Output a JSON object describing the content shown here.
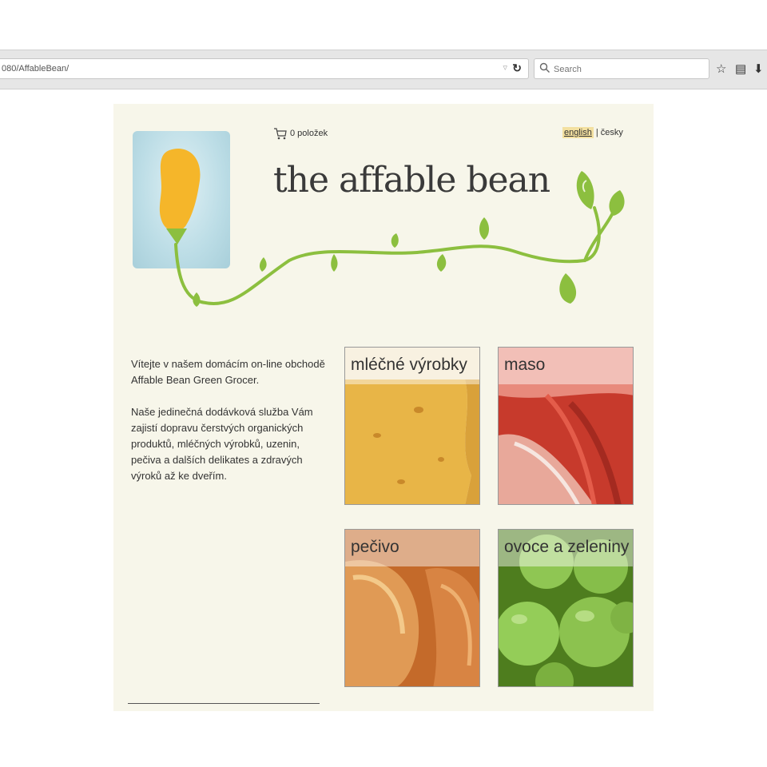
{
  "browser": {
    "url": "080/AffableBean/",
    "search_placeholder": "Search"
  },
  "header": {
    "cart_text": "0 položek",
    "lang_english": "english",
    "lang_separator": "|",
    "lang_czech": "česky",
    "brand": "the affable bean"
  },
  "welcome": {
    "para1": "Vítejte v našem domácím on-line obchodě Affable Bean Green Grocer.",
    "para2": "Naše jedinečná dodávková služba Vám zajistí dopravu čerstvých organických produktů, mléčných výrobků, uzenin, pečiva a dalších delikates a zdravých výroků až ke dveřím."
  },
  "categories": [
    {
      "name": "mléčné výrobky"
    },
    {
      "name": "maso"
    },
    {
      "name": "pečivo"
    },
    {
      "name": "ovoce a zeleniny"
    }
  ],
  "colors": {
    "page_bg": "#f7f6ea",
    "vine_green": "#8cbf3f",
    "bean_orange": "#f5b62a"
  }
}
